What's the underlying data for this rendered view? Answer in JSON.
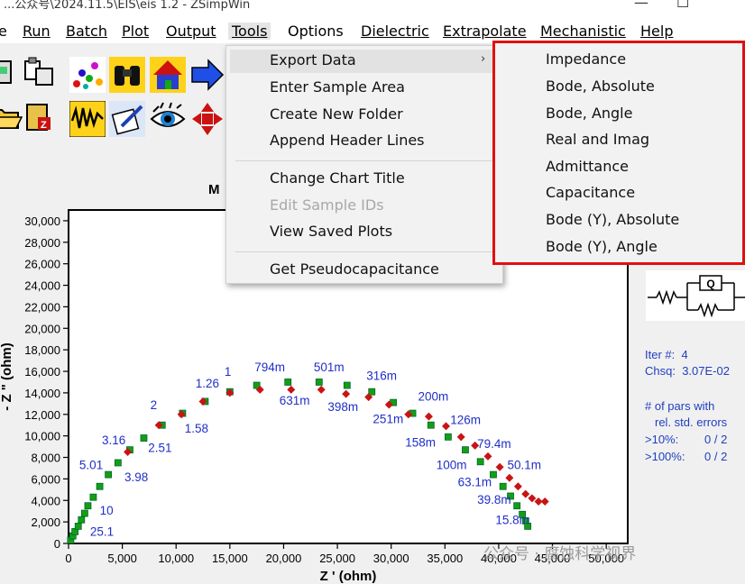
{
  "window": {
    "title": "...公众号\\2024.11.5\\EIS\\eis 1.2 - ZSimpWin",
    "minimize_glyph": "—",
    "maximize_glyph": "☐"
  },
  "menubar": {
    "items": [
      {
        "label": "e"
      },
      {
        "label": "Run"
      },
      {
        "label": "Batch"
      },
      {
        "label": "Plot"
      },
      {
        "label": "Output"
      },
      {
        "label": "Tools"
      },
      {
        "label": "Options"
      },
      {
        "label": "Dielectric"
      },
      {
        "label": "Extrapolate"
      },
      {
        "label": "Mechanistic"
      },
      {
        "label": "Help"
      }
    ]
  },
  "tools_menu": {
    "items": [
      {
        "label": "Export Data",
        "submenu": true
      },
      {
        "label": "Enter Sample Area"
      },
      {
        "label": "Create New Folder"
      },
      {
        "label": "Append Header Lines"
      },
      {
        "label": "Change Chart Title"
      },
      {
        "label": "Edit Sample IDs",
        "disabled": true
      },
      {
        "label": "View Saved Plots"
      },
      {
        "label": "Get Pseudocapacitance"
      }
    ],
    "submenu_arrow": "›"
  },
  "export_submenu": {
    "items": [
      {
        "label": "Impedance"
      },
      {
        "label": "Bode, Absolute"
      },
      {
        "label": "Bode, Angle"
      },
      {
        "label": "Real and  Imag"
      },
      {
        "label": "Admittance"
      },
      {
        "label": "Capacitance"
      },
      {
        "label": "Bode (Y), Absolute"
      },
      {
        "label": "Bode (Y), Angle"
      }
    ],
    "highlight_color": "#e01010"
  },
  "chart_title_fragment": "M",
  "right_panel": {
    "iter_label": "Iter #:",
    "iter_value": "4",
    "chsq_label": "Chsq:",
    "chsq_value": "3.07E-02",
    "pars_line1": "# of pars with",
    "pars_line2": "rel. std. errors",
    "gt10_label": ">10%:",
    "gt10_value": "0 / 2",
    "gt100_label": ">100%:",
    "gt100_value": "0 / 2",
    "circuit_element": "Q"
  },
  "watermark": "公众号 · 腐蚀科学视界",
  "chart_data": {
    "type": "scatter",
    "title": "M",
    "xlabel": "Z ' (ohm)",
    "ylabel": "- Z \" (ohm)",
    "xlim": [
      0,
      52000
    ],
    "ylim": [
      0,
      31000
    ],
    "xticks": [
      "0",
      "5,000",
      "10,000",
      "15,000",
      "20,000",
      "25,000",
      "30,000",
      "35,000",
      "40,000",
      "45,000",
      "50,000"
    ],
    "xtick_values": [
      0,
      5000,
      10000,
      15000,
      20000,
      25000,
      30000,
      35000,
      40000,
      45000,
      50000
    ],
    "yticks": [
      "0",
      "2,000",
      "4,000",
      "6,000",
      "8,000",
      "10,000",
      "12,000",
      "14,000",
      "16,000",
      "18,000",
      "20,000",
      "22,000",
      "24,000",
      "26,000",
      "28,000",
      "30,000"
    ],
    "ytick_values": [
      0,
      2000,
      4000,
      6000,
      8000,
      10000,
      12000,
      14000,
      16000,
      18000,
      20000,
      22000,
      24000,
      26000,
      28000,
      30000
    ],
    "series": [
      {
        "marker": "square",
        "color": "#12a012",
        "x": [
          200,
          400,
          600,
          900,
          1200,
          1500,
          1800,
          2300,
          2900,
          3700,
          4600,
          5700,
          7000,
          8700,
          10600,
          12700,
          15000,
          17500,
          20400,
          23300,
          25900,
          28200,
          30200,
          32000,
          33700,
          35300,
          36900,
          38300,
          39500,
          40400,
          41100,
          41700,
          42200,
          42500,
          42700
        ],
        "y": [
          300,
          700,
          1100,
          1600,
          2200,
          2800,
          3500,
          4300,
          5300,
          6400,
          7500,
          8700,
          9800,
          11000,
          12100,
          13200,
          14100,
          14700,
          15000,
          15000,
          14700,
          14100,
          13100,
          12100,
          11000,
          9900,
          8700,
          7600,
          6400,
          5300,
          4400,
          3500,
          2700,
          2100,
          1600
        ]
      },
      {
        "marker": "diamond",
        "color": "#c81414",
        "x": [
          5500,
          8400,
          10500,
          12500,
          15000,
          17800,
          20700,
          23500,
          25800,
          27900,
          29800,
          31600,
          33500,
          35100,
          36500,
          37800,
          39000,
          40100,
          41000,
          41800,
          42500,
          43100,
          43700,
          44300
        ],
        "y": [
          8500,
          11000,
          12000,
          13200,
          14000,
          14300,
          14300,
          14300,
          13900,
          13600,
          12900,
          12000,
          11800,
          10900,
          9900,
          9100,
          8100,
          7100,
          6100,
          5300,
          4600,
          4200,
          3900,
          3900
        ]
      }
    ],
    "annotations": [
      {
        "text": "1.26",
        "x": 11800,
        "y": 14500
      },
      {
        "text": "1",
        "x": 14500,
        "y": 15600
      },
      {
        "text": "794m",
        "x": 17300,
        "y": 16000
      },
      {
        "text": "501m",
        "x": 22800,
        "y": 16000
      },
      {
        "text": "316m",
        "x": 27700,
        "y": 15200
      },
      {
        "text": "631m",
        "x": 19600,
        "y": 12900
      },
      {
        "text": "398m",
        "x": 24100,
        "y": 12300
      },
      {
        "text": "200m",
        "x": 32500,
        "y": 13300
      },
      {
        "text": "251m",
        "x": 28300,
        "y": 11200
      },
      {
        "text": "126m",
        "x": 35500,
        "y": 11100
      },
      {
        "text": "158m",
        "x": 31300,
        "y": 9000
      },
      {
        "text": "79.4m",
        "x": 38000,
        "y": 8900
      },
      {
        "text": "100m",
        "x": 34200,
        "y": 6900
      },
      {
        "text": "50.1m",
        "x": 40800,
        "y": 6900
      },
      {
        "text": "63.1m",
        "x": 36200,
        "y": 5300
      },
      {
        "text": "39.8m",
        "x": 38000,
        "y": 3700
      },
      {
        "text": "15.8m",
        "x": 39700,
        "y": 1800
      },
      {
        "text": "2",
        "x": 7600,
        "y": 12500
      },
      {
        "text": "1.58",
        "x": 10800,
        "y": 10300
      },
      {
        "text": "3.16",
        "x": 3100,
        "y": 9200
      },
      {
        "text": "2.51",
        "x": 7400,
        "y": 8500
      },
      {
        "text": "5.01",
        "x": 1000,
        "y": 6900
      },
      {
        "text": "3.98",
        "x": 5200,
        "y": 5800
      },
      {
        "text": "10",
        "x": 2900,
        "y": 2700
      },
      {
        "text": "25.1",
        "x": 2000,
        "y": 700
      }
    ]
  }
}
